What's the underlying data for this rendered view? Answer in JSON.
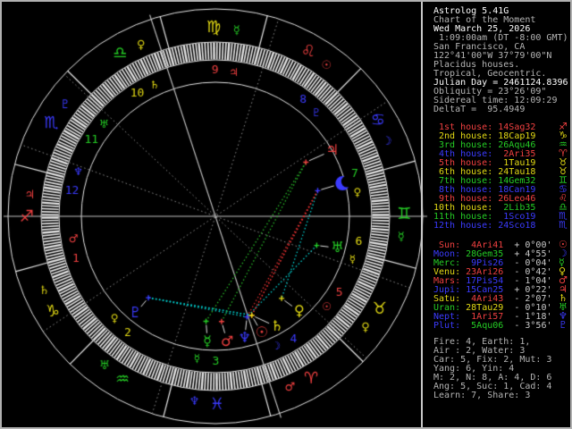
{
  "app": {
    "name": "Astrolog 5.41G"
  },
  "colors": {
    "fire": "#f04040",
    "earth": "#e3da14",
    "air": "#25cd25",
    "water": "#3b3bff",
    "bright": "#ffffff",
    "dim": "#b4b4b4",
    "speed": "#c8c8c8",
    "ring": "#e6e6e6",
    "axis": "#c0c0c0",
    "cusp_dotted": "#909090",
    "pointer": "#e0e0e0",
    "aspects": {
      "conjunction": "#d4d400",
      "square": "#e23030",
      "trine": "#28b828",
      "sextile": "#00d4d4"
    }
  },
  "panel": {
    "header": [
      {
        "text": "Astrolog 5.41G",
        "bright": true
      },
      {
        "text": "Chart of the Moment",
        "bright": false
      },
      {
        "text": "Wed March 25, 2026",
        "bright": true
      },
      {
        "text": " 1:09:00am (DT -8:00 GMT)",
        "bright": false
      },
      {
        "text": "San Francisco, CA",
        "bright": false
      },
      {
        "text": "122°41'00\"W 37°79'00\"N",
        "bright": false
      },
      {
        "text": "Placidus houses.",
        "bright": false
      },
      {
        "text": "Tropical, Geocentric.",
        "bright": false
      },
      {
        "text": "Julian Day = 2461124.8396",
        "bright": true
      },
      {
        "text": "Obliquity = 23°26'09\"",
        "bright": false
      },
      {
        "text": "Sidereal time: 12:09:29",
        "bright": false
      },
      {
        "text": "DeltaT =  95.4949",
        "bright": false
      }
    ],
    "houses": [
      {
        "label": " 1st house:",
        "value": "14Sag32",
        "label_color": "fire",
        "value_color": "fire",
        "glyph": "♐",
        "glyph_color": "fire"
      },
      {
        "label": " 2nd house:",
        "value": "18Cap19",
        "label_color": "earth",
        "value_color": "earth",
        "glyph": "♑",
        "glyph_color": "earth"
      },
      {
        "label": " 3rd house:",
        "value": "26Aqu46",
        "label_color": "air",
        "value_color": "air",
        "glyph": "♒",
        "glyph_color": "air"
      },
      {
        "label": " 4th house:",
        "value": " 2Ari35",
        "label_color": "water",
        "value_color": "fire",
        "glyph": "♈",
        "glyph_color": "fire"
      },
      {
        "label": " 5th house:",
        "value": " 1Tau19",
        "label_color": "fire",
        "value_color": "earth",
        "glyph": "♉",
        "glyph_color": "earth"
      },
      {
        "label": " 6th house:",
        "value": "24Tau18",
        "label_color": "earth",
        "value_color": "earth",
        "glyph": "♉",
        "glyph_color": "earth"
      },
      {
        "label": " 7th house:",
        "value": "14Gem32",
        "label_color": "air",
        "value_color": "air",
        "glyph": "♊",
        "glyph_color": "air"
      },
      {
        "label": " 8th house:",
        "value": "18Can19",
        "label_color": "water",
        "value_color": "water",
        "glyph": "♋",
        "glyph_color": "water"
      },
      {
        "label": " 9th house:",
        "value": "26Leo46",
        "label_color": "fire",
        "value_color": "fire",
        "glyph": "♌",
        "glyph_color": "fire"
      },
      {
        "label": "10th house:",
        "value": " 2Lib35",
        "label_color": "earth",
        "value_color": "air",
        "glyph": "♎",
        "glyph_color": "air"
      },
      {
        "label": "11th house:",
        "value": " 1Sco19",
        "label_color": "air",
        "value_color": "water",
        "glyph": "♏",
        "glyph_color": "water"
      },
      {
        "label": "12th house:",
        "value": "24Sco18",
        "label_color": "water",
        "value_color": "water",
        "glyph": "♏",
        "glyph_color": "water"
      }
    ],
    "planets": [
      {
        "label": " Sun:",
        "value": " 4Ari41",
        "speed": "+ 0°00'",
        "label_color": "fire",
        "value_color": "fire",
        "glyph": "☉",
        "glyph_color": "fire"
      },
      {
        "label": "Moon:",
        "value": "28Gem35",
        "speed": "+ 4°55'",
        "label_color": "water",
        "value_color": "air",
        "glyph": "☽",
        "glyph_color": "water"
      },
      {
        "label": "Merc:",
        "value": " 9Pis26",
        "speed": "- 0°04'",
        "label_color": "air",
        "value_color": "water",
        "glyph": "☿",
        "glyph_color": "air"
      },
      {
        "label": "Venu:",
        "value": "23Ari26",
        "speed": "- 0°42'",
        "label_color": "earth",
        "value_color": "fire",
        "glyph": "♀",
        "glyph_color": "earth"
      },
      {
        "label": "Mars:",
        "value": "17Pis54",
        "speed": "- 1°04'",
        "label_color": "fire",
        "value_color": "water",
        "glyph": "♂",
        "glyph_color": "fire"
      },
      {
        "label": "Jupi:",
        "value": "15Can25",
        "speed": "+ 0°22'",
        "label_color": "water",
        "value_color": "water",
        "glyph": "♃",
        "glyph_color": "fire"
      },
      {
        "label": "Satu:",
        "value": " 4Ari43",
        "speed": "- 2°07'",
        "label_color": "earth",
        "value_color": "fire",
        "glyph": "♄",
        "glyph_color": "earth"
      },
      {
        "label": "Uran:",
        "value": "28Tau29",
        "speed": "- 0°10'",
        "label_color": "air",
        "value_color": "earth",
        "glyph": "♅",
        "glyph_color": "air"
      },
      {
        "label": "Nept:",
        "value": " 1Ari57",
        "speed": "- 1°18'",
        "label_color": "water",
        "value_color": "fire",
        "glyph": "♆",
        "glyph_color": "water"
      },
      {
        "label": "Plut:",
        "value": " 5Aqu06",
        "speed": "- 3°56'",
        "label_color": "water",
        "value_color": "air",
        "glyph": "♇",
        "glyph_color": "water"
      }
    ],
    "summary": [
      "Fire: 4, Earth: 1,",
      "Air : 2, Water: 3",
      "Car: 5, Fix: 2, Mut: 3",
      "Yang: 6, Yin: 4",
      "M: 2, N: 8, A: 4, D: 6",
      "Ang: 5, Suc: 1, Cad: 4",
      "Learn: 7, Share: 3"
    ]
  },
  "wheel": {
    "ascendant_lon": 254.533,
    "house_cusps_lon": [
      254.533,
      288.317,
      326.767,
      2.583,
      31.317,
      54.3,
      74.533,
      108.317,
      146.767,
      182.583,
      211.317,
      234.3
    ],
    "house_number_colors": [
      "fire",
      "earth",
      "air",
      "water",
      "fire",
      "earth",
      "air",
      "water",
      "fire",
      "earth",
      "air",
      "water"
    ],
    "house_rulers": [
      {
        "glyph": "♂",
        "color": "fire"
      },
      {
        "glyph": "♀",
        "color": "earth"
      },
      {
        "glyph": "☿",
        "color": "air"
      },
      {
        "glyph": "☽",
        "color": "water"
      },
      {
        "glyph": "☉",
        "color": "fire"
      },
      {
        "glyph": "☿",
        "color": "earth"
      },
      {
        "glyph": "♀",
        "color": "earth"
      },
      {
        "glyph": "♇",
        "color": "water"
      },
      {
        "glyph": "♃",
        "color": "fire"
      },
      {
        "glyph": "♄",
        "color": "earth"
      },
      {
        "glyph": "♅",
        "color": "air"
      },
      {
        "glyph": "♆",
        "color": "water"
      }
    ],
    "signs": [
      {
        "name": "Aries",
        "glyph": "♈",
        "color": "fire",
        "ruler_glyph": "♂",
        "ruler_color": "fire"
      },
      {
        "name": "Taurus",
        "glyph": "♉",
        "color": "earth",
        "ruler_glyph": "♀",
        "ruler_color": "earth"
      },
      {
        "name": "Gemini",
        "glyph": "♊",
        "color": "air",
        "ruler_glyph": "☿",
        "ruler_color": "air"
      },
      {
        "name": "Cancer",
        "glyph": "♋",
        "color": "water",
        "ruler_glyph": "☽",
        "ruler_color": "water"
      },
      {
        "name": "Leo",
        "glyph": "♌",
        "color": "fire",
        "ruler_glyph": "☉",
        "ruler_color": "fire"
      },
      {
        "name": "Virgo",
        "glyph": "♍",
        "color": "earth",
        "ruler_glyph": "☿",
        "ruler_color": "air"
      },
      {
        "name": "Libra",
        "glyph": "♎",
        "color": "air",
        "ruler_glyph": "♀",
        "ruler_color": "earth"
      },
      {
        "name": "Scorpio",
        "glyph": "♏",
        "color": "water",
        "ruler_glyph": "♇",
        "ruler_color": "water"
      },
      {
        "name": "Sagittarius",
        "glyph": "♐",
        "color": "fire",
        "ruler_glyph": "♃",
        "ruler_color": "fire"
      },
      {
        "name": "Capricorn",
        "glyph": "♑",
        "color": "earth",
        "ruler_glyph": "♄",
        "ruler_color": "earth"
      },
      {
        "name": "Aquarius",
        "glyph": "♒",
        "color": "air",
        "ruler_glyph": "♅",
        "ruler_color": "air"
      },
      {
        "name": "Pisces",
        "glyph": "♓",
        "color": "water",
        "ruler_glyph": "♆",
        "ruler_color": "water"
      }
    ],
    "planets": [
      {
        "name": "Sun",
        "glyph": "☉",
        "lon": 4.683,
        "color": "fire",
        "glyph_r": 141,
        "glyph_dtheta": 1.5
      },
      {
        "name": "Moon",
        "glyph": "☽",
        "lon": 88.583,
        "color": "water",
        "glyph_r": 147,
        "glyph_dtheta": 0.5
      },
      {
        "name": "Mercury",
        "glyph": "☿",
        "lon": 339.433,
        "color": "air",
        "glyph_r": 141,
        "glyph_dtheta": 1.5
      },
      {
        "name": "Venus",
        "glyph": "♀",
        "lon": 23.433,
        "color": "earth",
        "glyph_r": 142,
        "glyph_dtheta": 2.5
      },
      {
        "name": "Mars",
        "glyph": "♂",
        "lon": 347.9,
        "color": "fire",
        "glyph_r": 141,
        "glyph_dtheta": 2
      },
      {
        "name": "Jupiter",
        "glyph": "♃",
        "lon": 105.417,
        "color": "fire",
        "glyph_r": 150,
        "glyph_dtheta": -1.5
      },
      {
        "name": "Saturn",
        "glyph": "♄",
        "lon": 4.717,
        "color": "earth",
        "glyph_r": 142,
        "glyph_dtheta": 9
      },
      {
        "name": "Uranus",
        "glyph": "♅",
        "lon": 58.483,
        "color": "air",
        "glyph_r": 141,
        "glyph_dtheta": 1.5
      },
      {
        "name": "Neptune",
        "glyph": "♆",
        "lon": 1.95,
        "color": "water",
        "glyph_r": 141,
        "glyph_dtheta": -4
      },
      {
        "name": "Pluto",
        "glyph": "♇",
        "lon": 305.1,
        "color": "water",
        "glyph_r": 141,
        "glyph_dtheta": 0
      }
    ],
    "aspects": [
      {
        "a": "Pluto",
        "b": "Sun",
        "type": "sextile"
      },
      {
        "a": "Pluto",
        "b": "Saturn",
        "type": "sextile"
      },
      {
        "a": "Pluto",
        "b": "Neptune",
        "type": "sextile"
      },
      {
        "a": "Moon",
        "b": "Venus",
        "type": "sextile"
      },
      {
        "a": "Uranus",
        "b": "Neptune",
        "type": "sextile"
      },
      {
        "a": "Moon",
        "b": "Sun",
        "type": "square"
      },
      {
        "a": "Moon",
        "b": "Saturn",
        "type": "square"
      },
      {
        "a": "Moon",
        "b": "Neptune",
        "type": "square"
      },
      {
        "a": "Mars",
        "b": "Jupiter",
        "type": "trine"
      },
      {
        "a": "Mercury",
        "b": "Jupiter",
        "type": "trine"
      },
      {
        "a": "Sun",
        "b": "Neptune",
        "type": "conjunction"
      },
      {
        "a": "Saturn",
        "b": "Neptune",
        "type": "conjunction"
      }
    ]
  }
}
